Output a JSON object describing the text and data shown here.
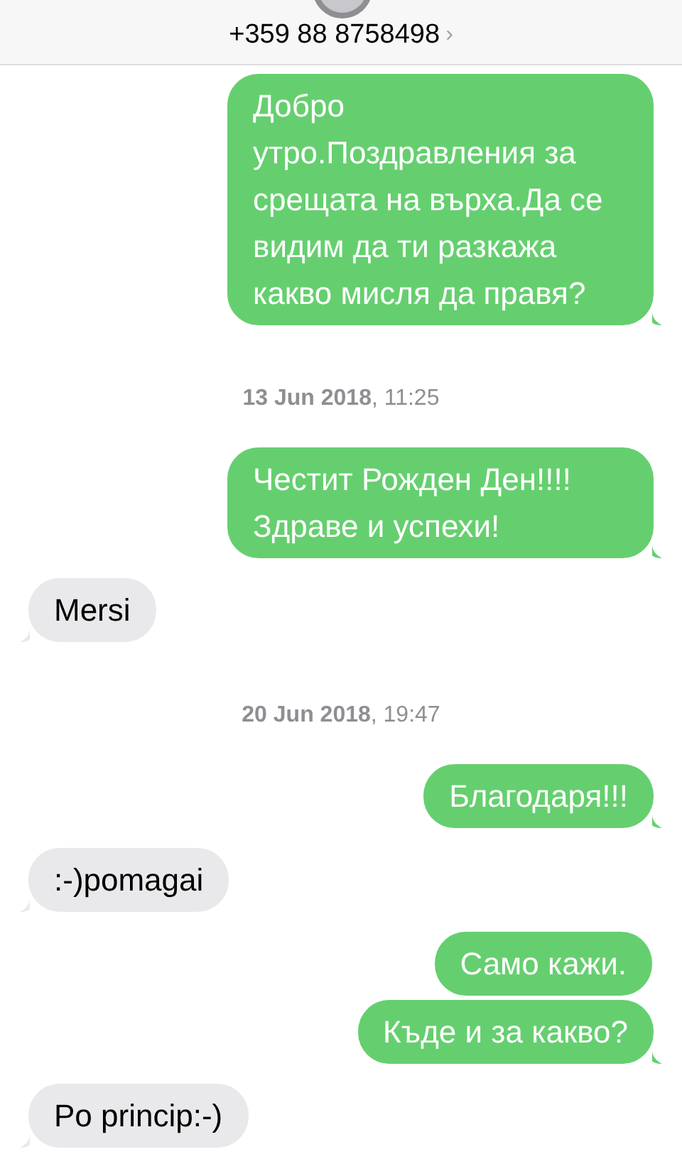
{
  "header": {
    "contact": "+359 88 8758498",
    "chevron": "›"
  },
  "messages": [
    {
      "kind": "sent",
      "tail": true,
      "text": "Добро утро.Поздравления за срещата на върха.Да се видим да ти разкажа какво мисля да правя?"
    },
    {
      "kind": "timestamp",
      "text": "**13 Jun 2018**, 11:25"
    },
    {
      "kind": "sent",
      "tail": true,
      "text": "Честит Рожден Ден!!!! Здраве и успехи!"
    },
    {
      "kind": "received",
      "tail": true,
      "text": "Mersi"
    },
    {
      "kind": "timestamp",
      "text": "**20 Jun 2018**, 19:47"
    },
    {
      "kind": "sent",
      "tail": true,
      "text": "Благодаря!!!"
    },
    {
      "kind": "received",
      "tail": true,
      "text": ":-)pomagai"
    },
    {
      "kind": "sent",
      "tail": false,
      "text": "Само кажи."
    },
    {
      "kind": "sent",
      "tail": true,
      "text": "Къде и за какво?"
    },
    {
      "kind": "received",
      "tail": true,
      "text": "Po princip:-)"
    }
  ]
}
